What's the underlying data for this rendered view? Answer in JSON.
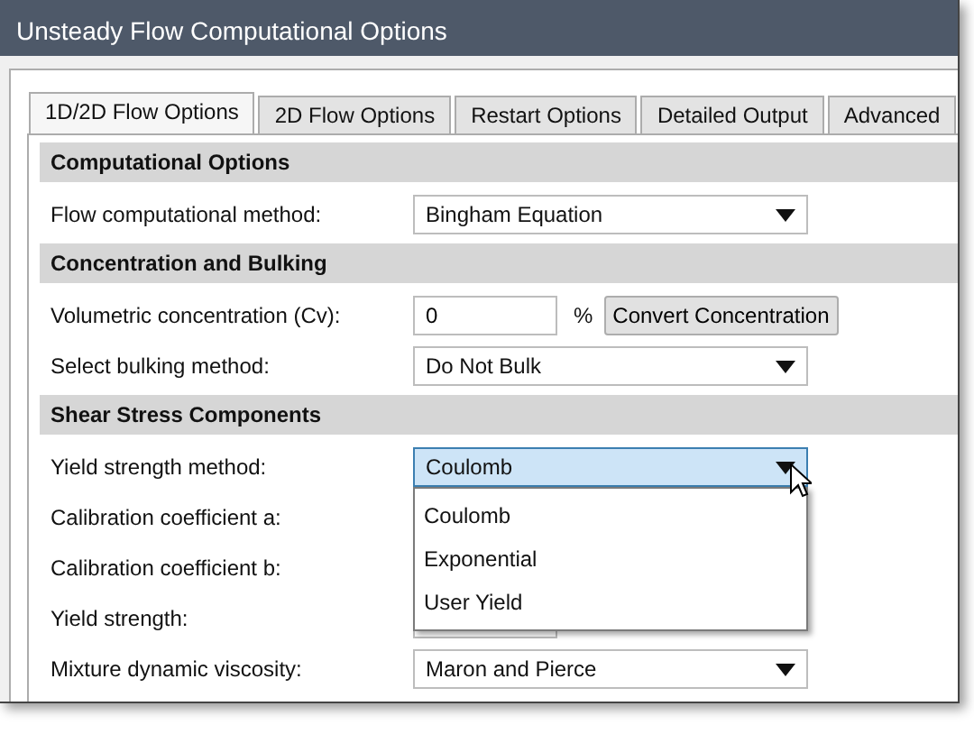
{
  "window": {
    "title": "Unsteady Flow Computational Options"
  },
  "tabs": [
    {
      "label": "1D/2D Flow Options",
      "selected": true
    },
    {
      "label": "2D Flow Options",
      "selected": false
    },
    {
      "label": "Restart Options",
      "selected": false
    },
    {
      "label": "Detailed Output",
      "selected": false
    },
    {
      "label": "Advanced",
      "selected": false
    }
  ],
  "sections": [
    {
      "title": "Computational Options",
      "rows": [
        {
          "label": "Flow computational method:",
          "kind": "select",
          "value": "Bingham Equation"
        }
      ]
    },
    {
      "title": "Concentration and Bulking",
      "rows": [
        {
          "label": "Volumetric concentration (Cv):",
          "kind": "number",
          "value": "0",
          "unit": "%",
          "button": "Convert Concentration"
        },
        {
          "label": "Select bulking method:",
          "kind": "select",
          "value": "Do Not Bulk"
        }
      ]
    },
    {
      "title": "Shear Stress Components",
      "rows": [
        {
          "label": "Yield strength method:",
          "kind": "select",
          "value": "Coulomb",
          "expanded": true,
          "options": [
            "Coulomb",
            "Exponential",
            "User Yield"
          ]
        },
        {
          "label": "Calibration coefficient a:",
          "kind": "hidden"
        },
        {
          "label": "Calibration coefficient b:",
          "kind": "hidden"
        },
        {
          "label": "Yield strength:",
          "kind": "number"
        },
        {
          "label": "Mixture dynamic viscosity:",
          "kind": "select",
          "value": "Maron and Pierce"
        }
      ]
    }
  ]
}
